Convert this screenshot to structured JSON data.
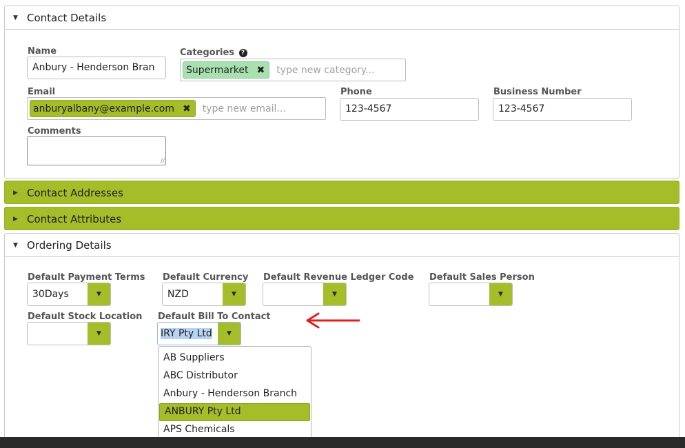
{
  "contact_details": {
    "title": "Contact Details",
    "name_label": "Name",
    "name_value": "Anbury - Henderson Bran",
    "categories_label": "Categories",
    "categories_help_icon": "question-circle-icon",
    "category_tag": "Supermarket",
    "category_placeholder": "type new category...",
    "category_tag_color": "#a8e0b0",
    "email_label": "Email",
    "email_tag": "anburyalbany@example.com",
    "email_placeholder": "type new email...",
    "email_tag_color": "#a6bd2a",
    "phone_label": "Phone",
    "phone_value": "123-4567",
    "business_number_label": "Business Number",
    "business_number_value": "123-4567",
    "comments_label": "Comments",
    "comments_value": ""
  },
  "collapsed_panels": [
    {
      "title": "Contact Addresses"
    },
    {
      "title": "Contact Attributes"
    }
  ],
  "ordering_details": {
    "title": "Ordering Details",
    "payment_terms_label": "Default Payment Terms",
    "payment_terms_value": "30Days",
    "currency_label": "Default Currency",
    "currency_value": "NZD",
    "revenue_ledger_label": "Default Revenue Ledger Code",
    "revenue_ledger_value": "",
    "sales_person_label": "Default Sales Person",
    "sales_person_value": "",
    "stock_location_label": "Default Stock Location",
    "stock_location_value": "",
    "bill_to_label": "Default Bill To Contact",
    "bill_to_value": "IRY Pty Ltd",
    "bill_to_options": [
      "AB Suppliers",
      "ABC Distributor",
      "Anbury - Henderson Branch",
      "ANBURY Pty Ltd",
      "APS Chemicals"
    ],
    "bill_to_highlighted": "ANBURY Pty Ltd"
  },
  "colors": {
    "accent": "#a6bd2a",
    "annotation_arrow": "#e02020"
  }
}
